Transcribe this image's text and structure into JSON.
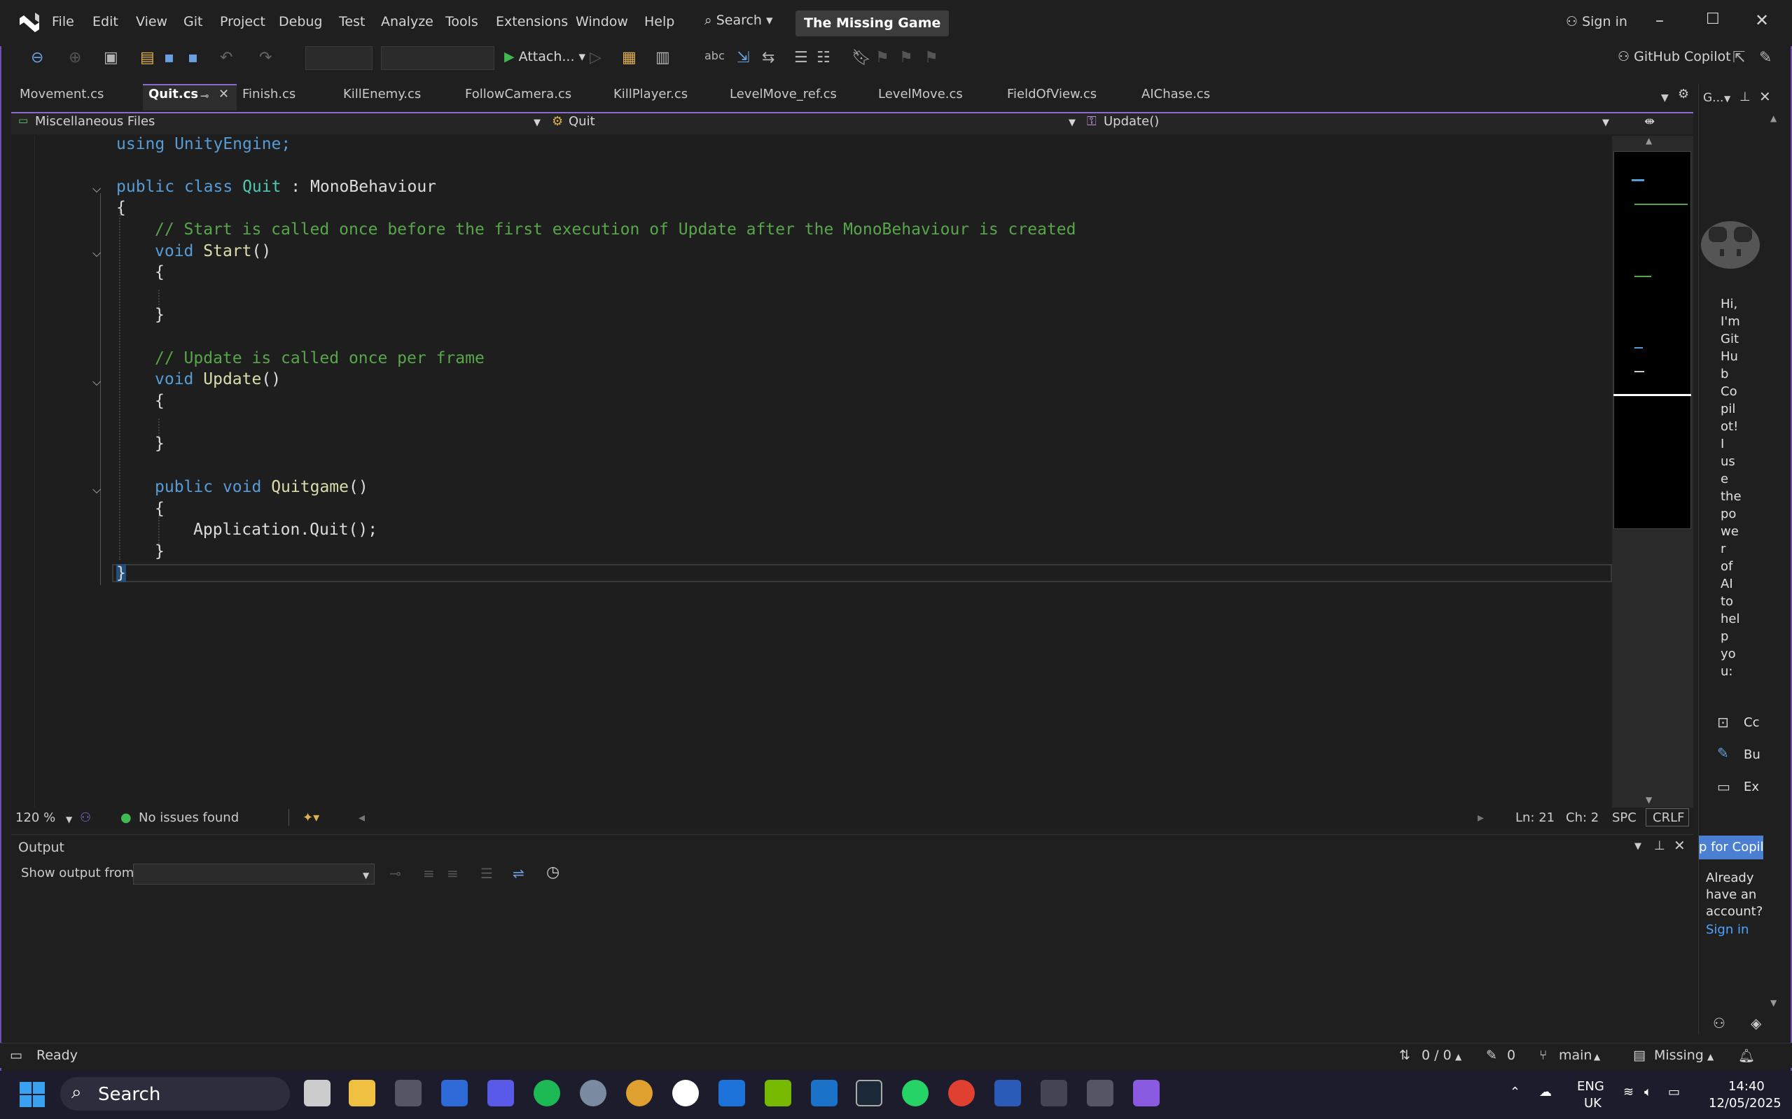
{
  "menu": {
    "items": [
      "File",
      "Edit",
      "View",
      "Git",
      "Project",
      "Debug",
      "Test",
      "Analyze",
      "Tools",
      "Extensions",
      "Window",
      "Help"
    ]
  },
  "search_label": "Search",
  "solution_name": "The Missing Game",
  "sign_in": "Sign in",
  "toolbar": {
    "attach_label": "Attach...",
    "copilot_label": "GitHub Copilot"
  },
  "tabs": [
    "Movement.cs",
    "Quit.cs",
    "Finish.cs",
    "KillEnemy.cs",
    "FollowCamera.cs",
    "KillPlayer.cs",
    "LevelMove_ref.cs",
    "LevelMove.cs",
    "FieldOfView.cs",
    "AIChase.cs"
  ],
  "active_tab": "Quit.cs",
  "nav": {
    "project": "Miscellaneous Files",
    "type": "Quit",
    "member": "Update()"
  },
  "code": {
    "l1": "using UnityEngine;",
    "l3a": "public",
    "l3b": "class",
    "l3c": "Quit",
    "l3d": " : MonoBehaviour",
    "l4": "{",
    "l5": "// Start is called once before the first execution of Update after the MonoBehaviour is created",
    "l6a": "void",
    "l6b": "Start",
    "l6c": "()",
    "l7": "{",
    "l9": "}",
    "l11": "// Update is called once per frame",
    "l12a": "void",
    "l12b": "Update",
    "l12c": "()",
    "l13": "{",
    "l15": "}",
    "l17a": "public",
    "l17b": "void",
    "l17c": "Quitgame",
    "l17d": "()",
    "l18": "{",
    "l19": "Application.Quit();",
    "l20": "}",
    "l21": "}"
  },
  "editor_status": {
    "zoom": "120 %",
    "issues": "No issues found",
    "line": "Ln: 21",
    "char": "Ch: 2",
    "spc": "SPC",
    "eol": "CRLF"
  },
  "output": {
    "title": "Output",
    "show_from": "Show output from:"
  },
  "copilot": {
    "short": "G...",
    "greeting": [
      "Hi,",
      "I'm",
      "Git",
      "Hu",
      "b",
      "Co",
      "pil",
      "ot!",
      "I",
      "us",
      "e",
      "the",
      "po",
      "we",
      "r",
      "of",
      "AI",
      "to",
      "hel",
      "p",
      "yo",
      "u:"
    ],
    "opt1": "Cc",
    "opt2": "Bu",
    "opt3": "Ex",
    "banner": "p for Copilo",
    "account": [
      "Already",
      "have an",
      "account?"
    ],
    "sign_in": "Sign in"
  },
  "statusbar": {
    "ready": "Ready",
    "sync": "0 / 0",
    "edits": "0",
    "branch": "main",
    "repo": "Missing"
  },
  "taskbar": {
    "search": "Search",
    "lang1": "ENG",
    "lang2": "UK",
    "time": "14:40",
    "date": "12/05/2025"
  },
  "colors": {
    "accent": "#8a6cd0",
    "keyword": "#569cd6",
    "type": "#4ec9b0",
    "method": "#dcdcaa",
    "comment": "#57a64a",
    "ok": "#3fb950"
  }
}
